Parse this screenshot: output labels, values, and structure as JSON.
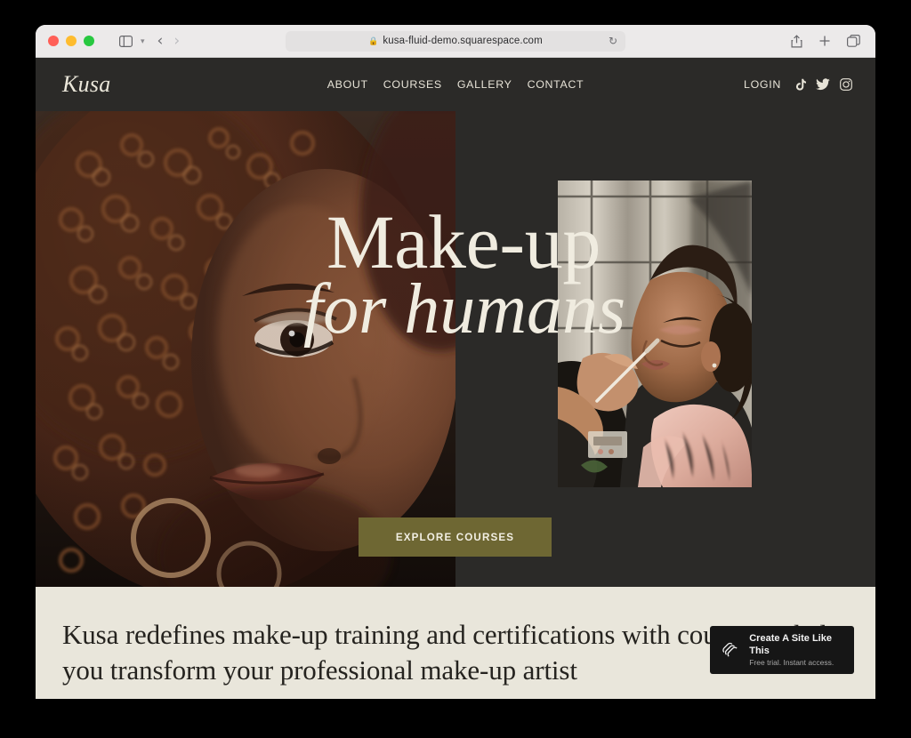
{
  "browser": {
    "url": "kusa-fluid-demo.squarespace.com",
    "lock_icon": "lock-icon",
    "reload_icon": "reload-icon",
    "sidebar_icon": "sidebar-toggle-icon",
    "chevron_icon": "chevron-down-icon",
    "back_icon": "back-arrow-icon",
    "forward_icon": "forward-arrow-icon",
    "share_icon": "share-icon",
    "newtab_icon": "plus-icon",
    "tabs_icon": "tab-overview-icon"
  },
  "site": {
    "logo": "Kusa",
    "nav": [
      {
        "label": "ABOUT"
      },
      {
        "label": "COURSES"
      },
      {
        "label": "GALLERY"
      },
      {
        "label": "CONTACT"
      }
    ],
    "login_label": "LOGIN",
    "social": [
      {
        "name": "tiktok-icon"
      },
      {
        "name": "twitter-icon"
      },
      {
        "name": "instagram-icon"
      }
    ],
    "hero": {
      "headline_line1": "Make-up",
      "headline_line2": "for humans",
      "cta_label": "EXPLORE COURSES",
      "left_image_alt": "close-up portrait of woman with curly auburn hair",
      "right_image_alt": "makeup artist applying makeup to seated client in pink fur coat"
    },
    "intro": {
      "paragraph": "Kusa redefines make-up training and certifications with courses to help you transform your professional make-up artist"
    }
  },
  "badge": {
    "title": "Create A Site Like This",
    "subtitle": "Free trial. Instant access.",
    "logo_icon": "squarespace-logo-icon"
  },
  "colors": {
    "site_dark": "#2b2a28",
    "cream": "#e9e6db",
    "olive": "#6e6733",
    "text_cream": "#f0ece0"
  }
}
